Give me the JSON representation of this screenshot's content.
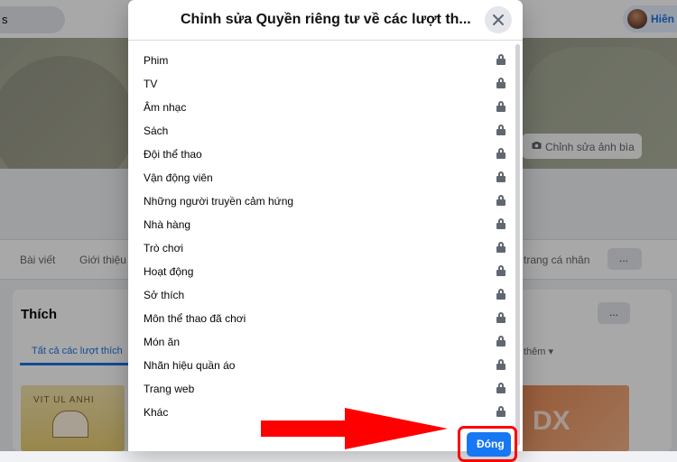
{
  "topbar": {
    "search_fragment": "s",
    "profile_name": "Hiên"
  },
  "cover": {
    "edit_cover_button": "Chỉnh sửa ảnh bìa",
    "camera_icon": "camera-icon"
  },
  "profile_tabs": {
    "posts": "Bài viết",
    "about": "Giới thiệu",
    "edit_profile_fragment": "trang cá nhân",
    "more_label": "..."
  },
  "likes_section": {
    "heading": "Thích",
    "more_label": "...",
    "tab_all_fragment": "Tất cả các lượt thích",
    "tab_more_fragment": "thêm ▾",
    "left_thumbnail_mark": "VIT UL ANHI",
    "right_thumbnail_mark": "DX"
  },
  "modal": {
    "title": "Chỉnh sửa Quyền riêng tư về các lượt th...",
    "close_icon": "close-icon",
    "lock_icon": "lock-icon",
    "items": [
      {
        "label": "Phim"
      },
      {
        "label": "TV"
      },
      {
        "label": "Âm nhạc"
      },
      {
        "label": "Sách"
      },
      {
        "label": "Đội thể thao"
      },
      {
        "label": "Vận động viên"
      },
      {
        "label": "Những người truyền cảm hứng"
      },
      {
        "label": "Nhà hàng"
      },
      {
        "label": "Trò chơi"
      },
      {
        "label": "Hoạt động"
      },
      {
        "label": "Sở thích"
      },
      {
        "label": "Môn thể thao đã chơi"
      },
      {
        "label": "Món ăn"
      },
      {
        "label": "Nhãn hiệu quần áo"
      },
      {
        "label": "Trang web"
      },
      {
        "label": "Khác"
      }
    ],
    "done_button": "Đóng"
  },
  "annotation": {
    "arrow_color": "#ff0000",
    "highlight_color": "#ff0000",
    "arrow_icon": "red-arrow-icon"
  },
  "colors": {
    "accent": "#1877f2",
    "overlay": "rgba(0,0,0,0.34)"
  }
}
